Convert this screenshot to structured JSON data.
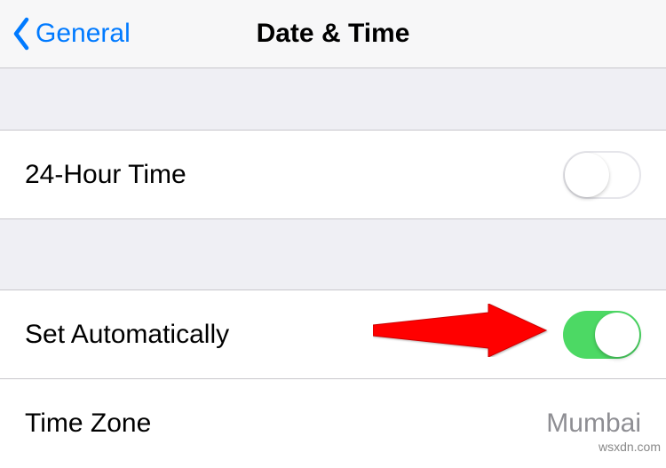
{
  "navbar": {
    "back_label": "General",
    "title": "Date & Time"
  },
  "rows": {
    "r24hour": {
      "label": "24-Hour Time",
      "toggle": false
    },
    "set_auto": {
      "label": "Set Automatically",
      "toggle": true
    },
    "timezone": {
      "label": "Time Zone",
      "value": "Mumbai"
    }
  },
  "annotation": {
    "arrow_color": "#ff0000"
  },
  "watermark": "wsxdn.com"
}
